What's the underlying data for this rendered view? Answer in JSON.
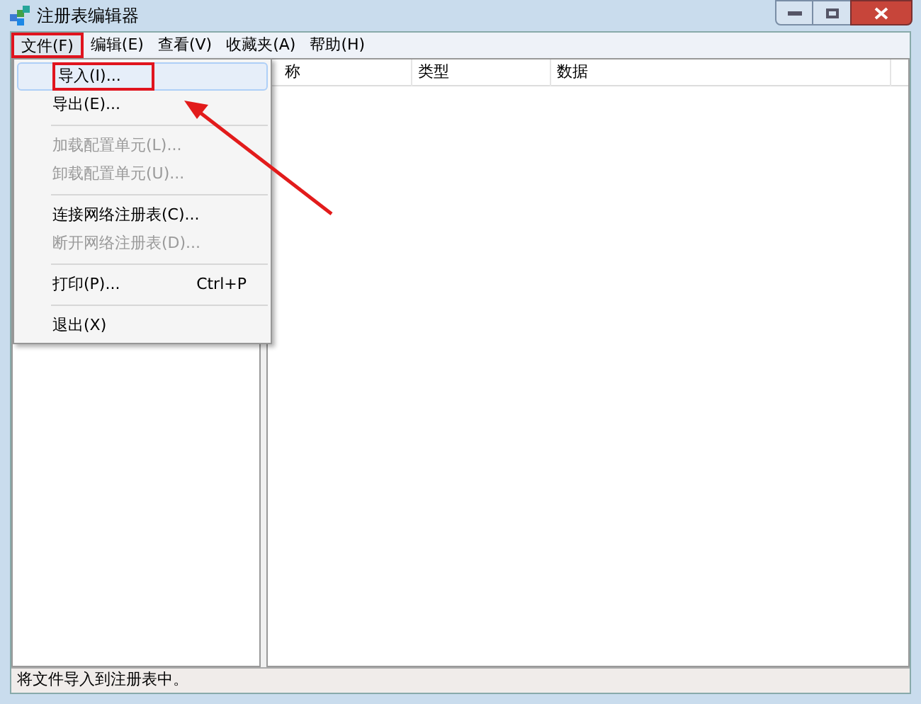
{
  "window": {
    "title": "注册表编辑器"
  },
  "menu_bar": [
    {
      "label": "文件(F)",
      "selected": true
    },
    {
      "label": "编辑(E)",
      "selected": false
    },
    {
      "label": "查看(V)",
      "selected": false
    },
    {
      "label": "收藏夹(A)",
      "selected": false
    },
    {
      "label": "帮助(H)",
      "selected": false
    }
  ],
  "file_menu": [
    {
      "kind": "item",
      "label": "导入(I)...",
      "disabled": false,
      "selected": true
    },
    {
      "kind": "item",
      "label": "导出(E)...",
      "disabled": false,
      "selected": false
    },
    {
      "kind": "separator"
    },
    {
      "kind": "item",
      "label": "加载配置单元(L)...",
      "disabled": true,
      "selected": false
    },
    {
      "kind": "item",
      "label": "卸载配置单元(U)...",
      "disabled": true,
      "selected": false
    },
    {
      "kind": "separator"
    },
    {
      "kind": "item",
      "label": "连接网络注册表(C)...",
      "disabled": false,
      "selected": false
    },
    {
      "kind": "item",
      "label": "断开网络注册表(D)...",
      "disabled": true,
      "selected": false
    },
    {
      "kind": "separator"
    },
    {
      "kind": "item",
      "label": "打印(P)...",
      "shortcut": "Ctrl+P",
      "disabled": false,
      "selected": false
    },
    {
      "kind": "separator"
    },
    {
      "kind": "item",
      "label": "退出(X)",
      "disabled": false,
      "selected": false
    }
  ],
  "table": {
    "columns": [
      "称",
      "类型",
      "数据"
    ]
  },
  "status_bar": "将文件导入到注册表中。"
}
